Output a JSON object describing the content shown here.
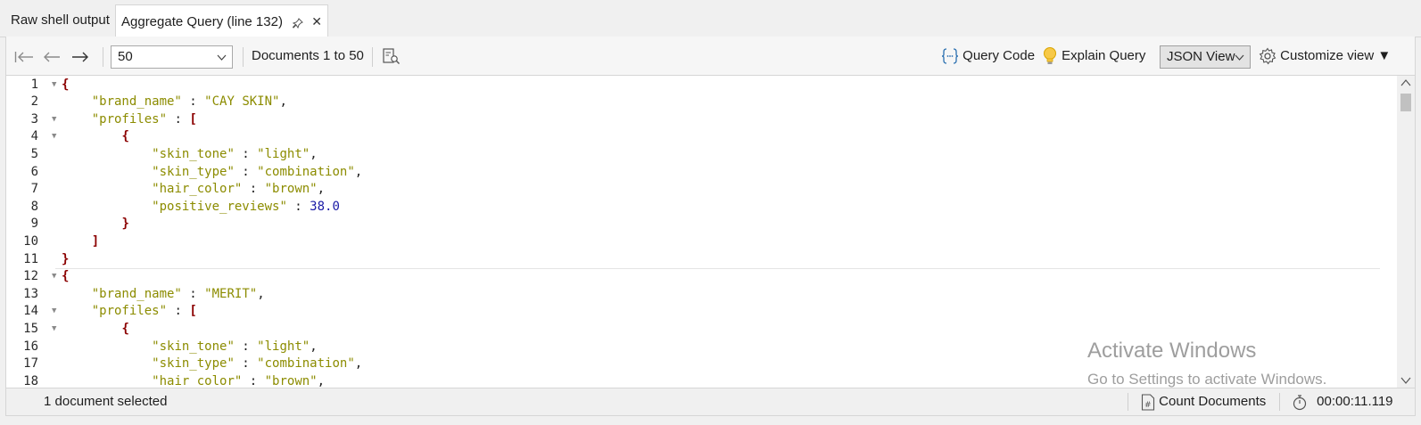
{
  "tabs": {
    "raw_label": "Raw shell output",
    "active_label": "Aggregate Query (line 132)",
    "pin_icon": "pin-icon",
    "close_icon": "close-icon"
  },
  "toolbar": {
    "page_size": "50",
    "documents_label": "Documents 1 to 50",
    "query_code_label": "Query Code",
    "explain_query_label": "Explain Query",
    "view_mode": "JSON View",
    "customize_label": "Customize view",
    "customize_caret": "▼"
  },
  "editor": {
    "lines": [
      {
        "n": "1",
        "fold": "▼",
        "indent": 0,
        "parts": [
          {
            "c": "p",
            "t": "{"
          }
        ]
      },
      {
        "n": "2",
        "fold": "",
        "indent": 4,
        "parts": [
          {
            "c": "k",
            "t": "\"brand_name\""
          },
          {
            "c": "o",
            "t": " : "
          },
          {
            "c": "s",
            "t": "\"CAY SKIN\""
          },
          {
            "c": "o",
            "t": ","
          }
        ]
      },
      {
        "n": "3",
        "fold": "▼",
        "indent": 4,
        "parts": [
          {
            "c": "k",
            "t": "\"profiles\""
          },
          {
            "c": "o",
            "t": " : "
          },
          {
            "c": "p",
            "t": "["
          }
        ]
      },
      {
        "n": "4",
        "fold": "▼",
        "indent": 8,
        "parts": [
          {
            "c": "p",
            "t": "{"
          }
        ]
      },
      {
        "n": "5",
        "fold": "",
        "indent": 12,
        "parts": [
          {
            "c": "k",
            "t": "\"skin_tone\""
          },
          {
            "c": "o",
            "t": " : "
          },
          {
            "c": "s",
            "t": "\"light\""
          },
          {
            "c": "o",
            "t": ","
          }
        ]
      },
      {
        "n": "6",
        "fold": "",
        "indent": 12,
        "parts": [
          {
            "c": "k",
            "t": "\"skin_type\""
          },
          {
            "c": "o",
            "t": " : "
          },
          {
            "c": "s",
            "t": "\"combination\""
          },
          {
            "c": "o",
            "t": ","
          }
        ]
      },
      {
        "n": "7",
        "fold": "",
        "indent": 12,
        "parts": [
          {
            "c": "k",
            "t": "\"hair_color\""
          },
          {
            "c": "o",
            "t": " : "
          },
          {
            "c": "s",
            "t": "\"brown\""
          },
          {
            "c": "o",
            "t": ","
          }
        ]
      },
      {
        "n": "8",
        "fold": "",
        "indent": 12,
        "parts": [
          {
            "c": "k",
            "t": "\"positive_reviews\""
          },
          {
            "c": "o",
            "t": " : "
          },
          {
            "c": "n",
            "t": "38.0"
          }
        ]
      },
      {
        "n": "9",
        "fold": "",
        "indent": 8,
        "parts": [
          {
            "c": "p",
            "t": "}"
          }
        ]
      },
      {
        "n": "10",
        "fold": "",
        "indent": 4,
        "parts": [
          {
            "c": "p",
            "t": "]"
          }
        ]
      },
      {
        "n": "11",
        "fold": "",
        "indent": 0,
        "parts": [
          {
            "c": "p",
            "t": "}"
          }
        ]
      },
      {
        "n": "12",
        "fold": "▼",
        "indent": 0,
        "parts": [
          {
            "c": "p",
            "t": "{"
          }
        ]
      },
      {
        "n": "13",
        "fold": "",
        "indent": 4,
        "parts": [
          {
            "c": "k",
            "t": "\"brand_name\""
          },
          {
            "c": "o",
            "t": " : "
          },
          {
            "c": "s",
            "t": "\"MERIT\""
          },
          {
            "c": "o",
            "t": ","
          }
        ]
      },
      {
        "n": "14",
        "fold": "▼",
        "indent": 4,
        "parts": [
          {
            "c": "k",
            "t": "\"profiles\""
          },
          {
            "c": "o",
            "t": " : "
          },
          {
            "c": "p",
            "t": "["
          }
        ]
      },
      {
        "n": "15",
        "fold": "▼",
        "indent": 8,
        "parts": [
          {
            "c": "p",
            "t": "{"
          }
        ]
      },
      {
        "n": "16",
        "fold": "",
        "indent": 12,
        "parts": [
          {
            "c": "k",
            "t": "\"skin_tone\""
          },
          {
            "c": "o",
            "t": " : "
          },
          {
            "c": "s",
            "t": "\"light\""
          },
          {
            "c": "o",
            "t": ","
          }
        ]
      },
      {
        "n": "17",
        "fold": "",
        "indent": 12,
        "parts": [
          {
            "c": "k",
            "t": "\"skin_type\""
          },
          {
            "c": "o",
            "t": " : "
          },
          {
            "c": "s",
            "t": "\"combination\""
          },
          {
            "c": "o",
            "t": ","
          }
        ]
      },
      {
        "n": "18",
        "fold": "",
        "indent": 12,
        "parts": [
          {
            "c": "k",
            "t": "\"hair_color\""
          },
          {
            "c": "o",
            "t": " : "
          },
          {
            "c": "s",
            "t": "\"brown\""
          },
          {
            "c": "o",
            "t": ","
          }
        ]
      }
    ]
  },
  "watermark": {
    "title": "Activate Windows",
    "subtitle": "Go to Settings to activate Windows."
  },
  "status": {
    "selection": "1 document selected",
    "count_label": "Count Documents",
    "elapsed": "00:00:11.119"
  }
}
